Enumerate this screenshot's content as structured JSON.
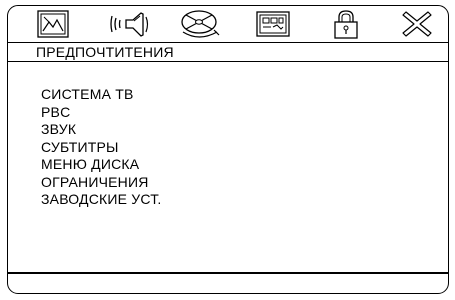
{
  "toolbar": {
    "icons": [
      "picture-icon",
      "audio-speaker-icon",
      "disc-icon",
      "settings-board-icon",
      "lock-icon",
      "close-icon"
    ]
  },
  "header": {
    "title": "ПРЕДПОЧТИТЕНИЯ"
  },
  "menu": {
    "items": [
      "СИСТЕМА ТВ",
      "PBC",
      "ЗВУК",
      "СУБТИТРЫ",
      "МЕНЮ ДИСКА",
      "ОГРАНИЧЕНИЯ",
      "ЗАВОДСКИЕ УСТ."
    ]
  }
}
